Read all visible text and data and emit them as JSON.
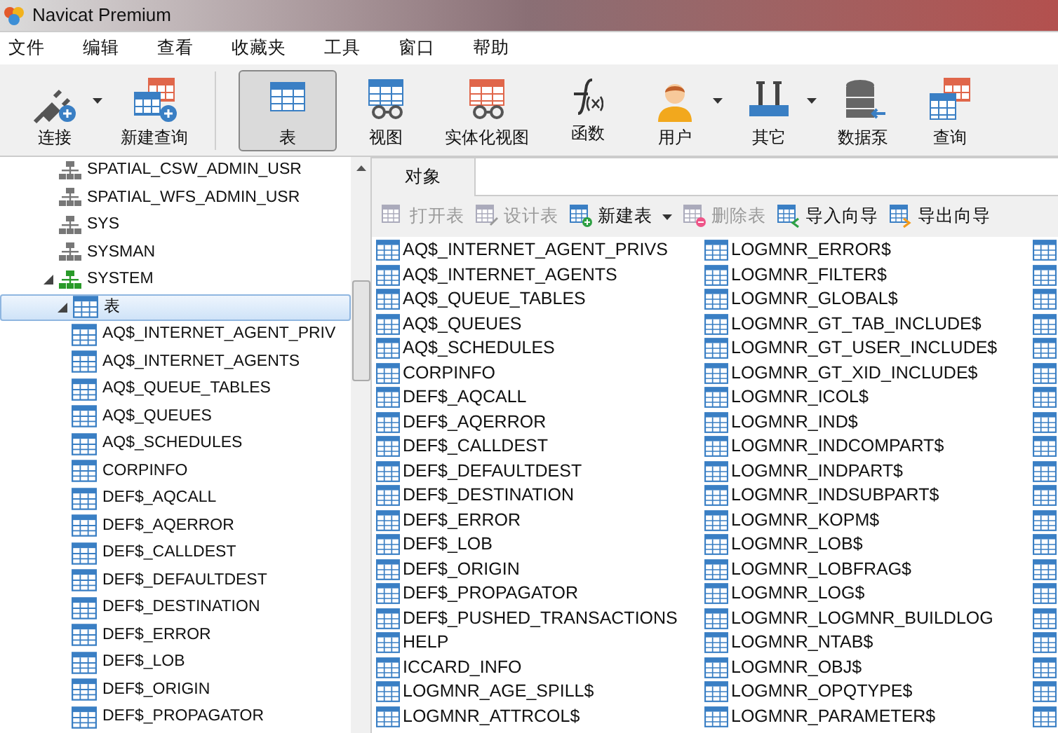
{
  "window": {
    "title": "Navicat Premium"
  },
  "menu": [
    "文件",
    "编辑",
    "查看",
    "收藏夹",
    "工具",
    "窗口",
    "帮助"
  ],
  "toolbar": [
    {
      "label": "连接",
      "kind": "connect",
      "dropdown": true,
      "selected": false
    },
    {
      "label": "新建查询",
      "kind": "newquery",
      "selected": false
    },
    {
      "label": "表",
      "kind": "table",
      "selected": true
    },
    {
      "label": "视图",
      "kind": "view",
      "selected": false
    },
    {
      "label": "实体化视图",
      "kind": "mview",
      "selected": false
    },
    {
      "label": "函数",
      "kind": "function",
      "selected": false
    },
    {
      "label": "用户",
      "kind": "user",
      "dropdown": true,
      "selected": false
    },
    {
      "label": "其它",
      "kind": "tools",
      "dropdown": true,
      "selected": false
    },
    {
      "label": "数据泵",
      "kind": "pump",
      "selected": false
    },
    {
      "label": "查询",
      "kind": "query",
      "selected": false
    }
  ],
  "tree": [
    {
      "label": "SPATIAL_CSW_ADMIN_USR",
      "kind": "schema",
      "expanded": false,
      "selected": false
    },
    {
      "label": "SPATIAL_WFS_ADMIN_USR",
      "kind": "schema",
      "expanded": false,
      "selected": false
    },
    {
      "label": "SYS",
      "kind": "schema",
      "expanded": false,
      "selected": false
    },
    {
      "label": "SYSMAN",
      "kind": "schema",
      "expanded": false,
      "selected": false
    },
    {
      "label": "SYSTEM",
      "kind": "schema-open",
      "expanded": true,
      "selected": false,
      "children": [
        {
          "label": "表",
          "kind": "folder",
          "expanded": true,
          "selected": true,
          "children": [
            {
              "label": "AQ$_INTERNET_AGENT_PRIV",
              "kind": "table",
              "selected": false
            },
            {
              "label": "AQ$_INTERNET_AGENTS",
              "kind": "table",
              "selected": false
            },
            {
              "label": "AQ$_QUEUE_TABLES",
              "kind": "table",
              "selected": false
            },
            {
              "label": "AQ$_QUEUES",
              "kind": "table",
              "selected": false
            },
            {
              "label": "AQ$_SCHEDULES",
              "kind": "table",
              "selected": false
            },
            {
              "label": "CORPINFO",
              "kind": "table",
              "selected": false
            },
            {
              "label": "DEF$_AQCALL",
              "kind": "table",
              "selected": false
            },
            {
              "label": "DEF$_AQERROR",
              "kind": "table",
              "selected": false
            },
            {
              "label": "DEF$_CALLDEST",
              "kind": "table",
              "selected": false
            },
            {
              "label": "DEF$_DEFAULTDEST",
              "kind": "table",
              "selected": false
            },
            {
              "label": "DEF$_DESTINATION",
              "kind": "table",
              "selected": false
            },
            {
              "label": "DEF$_ERROR",
              "kind": "table",
              "selected": false
            },
            {
              "label": "DEF$_LOB",
              "kind": "table",
              "selected": false
            },
            {
              "label": "DEF$_ORIGIN",
              "kind": "table",
              "selected": false
            },
            {
              "label": "DEF$_PROPAGATOR",
              "kind": "table",
              "selected": false
            }
          ]
        }
      ]
    }
  ],
  "tabs": [
    {
      "label": "对象",
      "selected": true
    }
  ],
  "object_toolbar": [
    {
      "label": "打开表",
      "kind": "open",
      "disabled": true
    },
    {
      "label": "设计表",
      "kind": "design",
      "disabled": true
    },
    {
      "label": "新建表",
      "kind": "new",
      "disabled": false,
      "dropdown": true
    },
    {
      "label": "删除表",
      "kind": "delete",
      "disabled": true
    },
    {
      "label": "导入向导",
      "kind": "import",
      "disabled": false
    },
    {
      "label": "导出向导",
      "kind": "export",
      "disabled": false
    }
  ],
  "objects": {
    "column_1": [
      "AQ$_INTERNET_AGENT_PRIVS",
      "AQ$_INTERNET_AGENTS",
      "AQ$_QUEUE_TABLES",
      "AQ$_QUEUES",
      "AQ$_SCHEDULES",
      "CORPINFO",
      "DEF$_AQCALL",
      "DEF$_AQERROR",
      "DEF$_CALLDEST",
      "DEF$_DEFAULTDEST",
      "DEF$_DESTINATION",
      "DEF$_ERROR",
      "DEF$_LOB",
      "DEF$_ORIGIN",
      "DEF$_PROPAGATOR",
      "DEF$_PUSHED_TRANSACTIONS",
      "HELP",
      "ICCARD_INFO",
      "LOGMNR_AGE_SPILL$",
      "LOGMNR_ATTRCOL$"
    ],
    "column_2": [
      "LOGMNR_ERROR$",
      "LOGMNR_FILTER$",
      "LOGMNR_GLOBAL$",
      "LOGMNR_GT_TAB_INCLUDE$",
      "LOGMNR_GT_USER_INCLUDE$",
      "LOGMNR_GT_XID_INCLUDE$",
      "LOGMNR_ICOL$",
      "LOGMNR_IND$",
      "LOGMNR_INDCOMPART$",
      "LOGMNR_INDPART$",
      "LOGMNR_INDSUBPART$",
      "LOGMNR_KOPM$",
      "LOGMNR_LOB$",
      "LOGMNR_LOBFRAG$",
      "LOGMNR_LOG$",
      "LOGMNR_LOGMNR_BUILDLOG",
      "LOGMNR_NTAB$",
      "LOGMNR_OBJ$",
      "LOGMNR_OPQTYPE$",
      "LOGMNR_PARAMETER$"
    ]
  }
}
